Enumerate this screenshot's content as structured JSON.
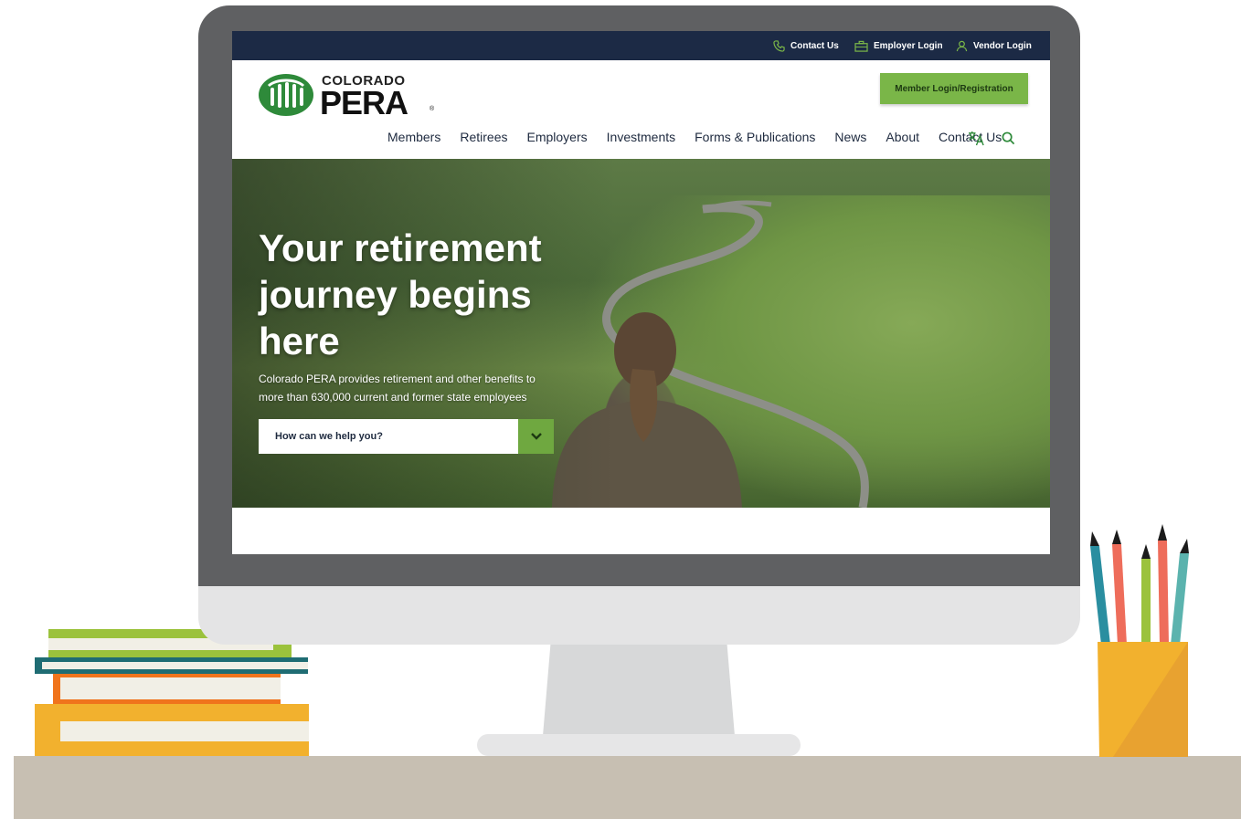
{
  "utility_bar": {
    "contact_us": "Contact Us",
    "employer_login": "Employer Login",
    "vendor_login": "Vendor Login"
  },
  "logo": {
    "top_word": "COLORADO",
    "main_word": "PERA",
    "reg_mark": "®"
  },
  "header": {
    "login_button": "Member Login/Registration"
  },
  "nav": {
    "items": [
      {
        "label": "Members"
      },
      {
        "label": "Retirees"
      },
      {
        "label": "Employers"
      },
      {
        "label": "Investments"
      },
      {
        "label": "Forms & Publications"
      },
      {
        "label": "News"
      },
      {
        "label": "About"
      },
      {
        "label": "Contact Us"
      }
    ]
  },
  "hero": {
    "title": "Your retirement journey begins here",
    "subtitle": "Colorado PERA provides retirement and other benefits to more than 630,000 current and former state employees",
    "help_select": "How can we help you?"
  },
  "colors": {
    "brand_green": "#7ab648",
    "navy": "#1c2a45",
    "logo_green": "#2e8a3a"
  },
  "icons": {
    "contact": "phone-icon",
    "employer": "briefcase-icon",
    "vendor": "person-icon",
    "translate": "translate-icon",
    "search": "search-icon",
    "dropdown": "chevron-down-icon"
  }
}
